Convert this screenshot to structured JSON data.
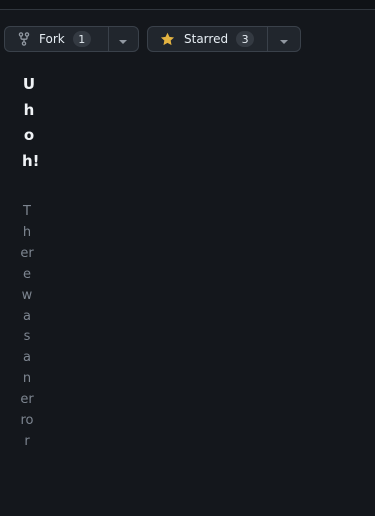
{
  "fork": {
    "label": "Fork",
    "count": "1",
    "icon": "fork-icon"
  },
  "star": {
    "label": "Starred",
    "count": "3",
    "icon": "star-icon",
    "icon_color": "#e3b341"
  },
  "error": {
    "title": "Uh oh!",
    "message": "There was an error"
  },
  "colors": {
    "background": "#14171c",
    "button_bg": "#21262d",
    "button_border": "#3a414a",
    "text_primary": "#e6edf3",
    "text_muted": "#7d8590"
  }
}
